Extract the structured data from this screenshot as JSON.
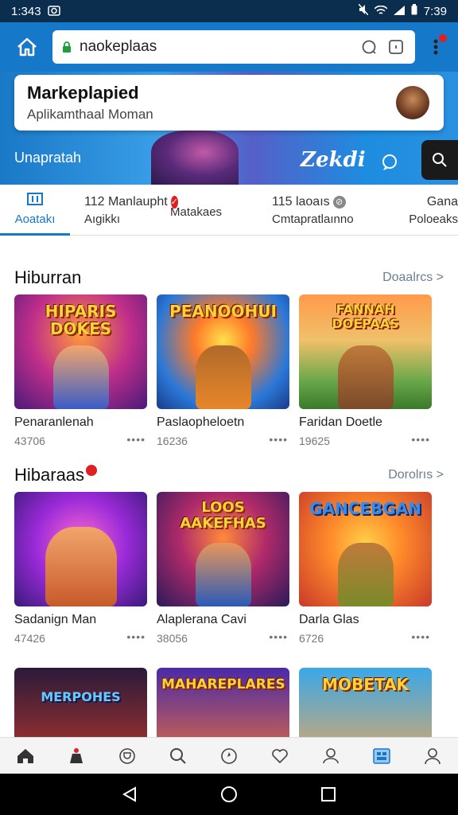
{
  "status": {
    "time": "1:343",
    "right_time": "7:39"
  },
  "browser": {
    "url": "naokeplaas"
  },
  "hero": {
    "title": "Markeplapied",
    "subtitle": "Aplikamthaal Moman",
    "label": "Unapratah",
    "brand": "Zekdi"
  },
  "tabs": [
    {
      "top": "",
      "bottom": "Aoatakı"
    },
    {
      "top": "112 Manlaupht",
      "bottom": "Aıgikkı"
    },
    {
      "top": "",
      "bottom": "Matakaes"
    },
    {
      "top": "115 laoaıs",
      "bottom": "Cmtapratlaınno"
    },
    {
      "top": "Gana",
      "bottom": "Poloeaks"
    }
  ],
  "sections": [
    {
      "title": "Hiburran",
      "more": "Doaalrcs >",
      "cards": [
        {
          "art": "HIPARIS DOKES",
          "name": "Penaranlenah",
          "count": "43706"
        },
        {
          "art": "PEANOOHUI",
          "name": "Paslaopheloetn",
          "count": "16236"
        },
        {
          "art": "FANNAH DOEPAAS",
          "name": "Faridan Doetle",
          "count": "19625"
        }
      ]
    },
    {
      "title": "Hibaraas",
      "more": "Dorolrıs >",
      "cards": [
        {
          "art": "",
          "name": "Sadanign Man",
          "count": "47426"
        },
        {
          "art": "LOOS AAKEFHAS",
          "name": "Alaplerana Cavi",
          "count": "38056"
        },
        {
          "art": "GANCEBGAN",
          "name": "Darla Glas",
          "count": "6726"
        }
      ]
    },
    {
      "title": "",
      "more": "",
      "cards": [
        {
          "art": "MERPOHES",
          "name": "",
          "count": ""
        },
        {
          "art": "MAHAREPLARES",
          "name": "",
          "count": ""
        },
        {
          "art": "MOBETAK",
          "name": "",
          "count": ""
        }
      ]
    }
  ],
  "icons": {
    "nav": [
      "home-icon",
      "store-icon",
      "trophy-icon",
      "search-icon",
      "compass-icon",
      "heart-icon",
      "user-group-icon",
      "apps-icon",
      "profile-icon"
    ]
  },
  "colors": {
    "primary": "#1678c8",
    "status_bar": "#0b2e4f",
    "badge": "#e02020"
  }
}
